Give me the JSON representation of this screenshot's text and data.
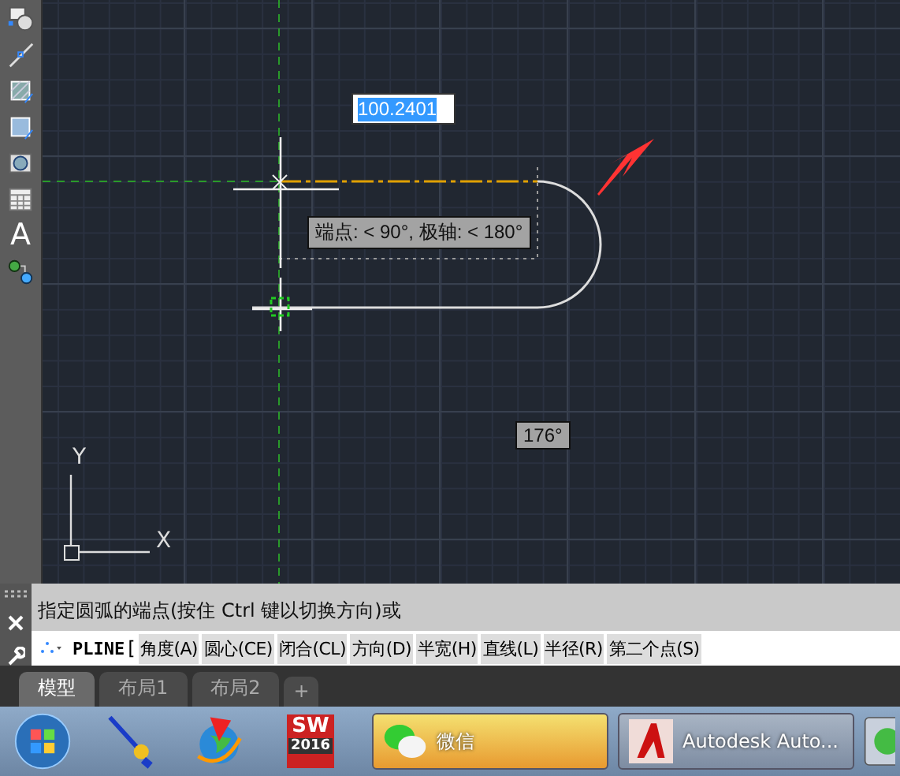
{
  "toolbar": {
    "text_tool_glyph": "A"
  },
  "canvas": {
    "dynamic_input": "100.2401",
    "tracking_tooltip": "端点: < 90°,  极轴: < 180°",
    "angle_tooltip": "176°",
    "ucs": {
      "x_label": "X",
      "y_label": "Y"
    }
  },
  "command_line": {
    "history": "指定圆弧的端点(按住 Ctrl 键以切换方向)或",
    "command": "PLINE",
    "bracket": "[",
    "options": [
      "角度(A)",
      "圆心(CE)",
      "闭合(CL)",
      "方向(D)",
      "半宽(H)",
      "直线(L)",
      "半径(R)",
      "第二个点(S)"
    ]
  },
  "layout_tabs": {
    "tabs": [
      {
        "label": "模型",
        "selected": true
      },
      {
        "label": "布局1",
        "selected": false
      },
      {
        "label": "布局2",
        "selected": false
      }
    ],
    "add_tab": "+"
  },
  "taskbar": {
    "pinned": [
      {
        "kind": "start"
      },
      {
        "kind": "pointer"
      },
      {
        "kind": "globe"
      },
      {
        "kind": "logo",
        "label": "SW",
        "badge": "2016"
      }
    ],
    "windows": [
      {
        "kind": "chat",
        "label": "微信",
        "selected": true
      },
      {
        "kind": "cad",
        "label": "Autodesk Auto...",
        "selected": false
      },
      {
        "kind": "partial"
      }
    ]
  }
}
